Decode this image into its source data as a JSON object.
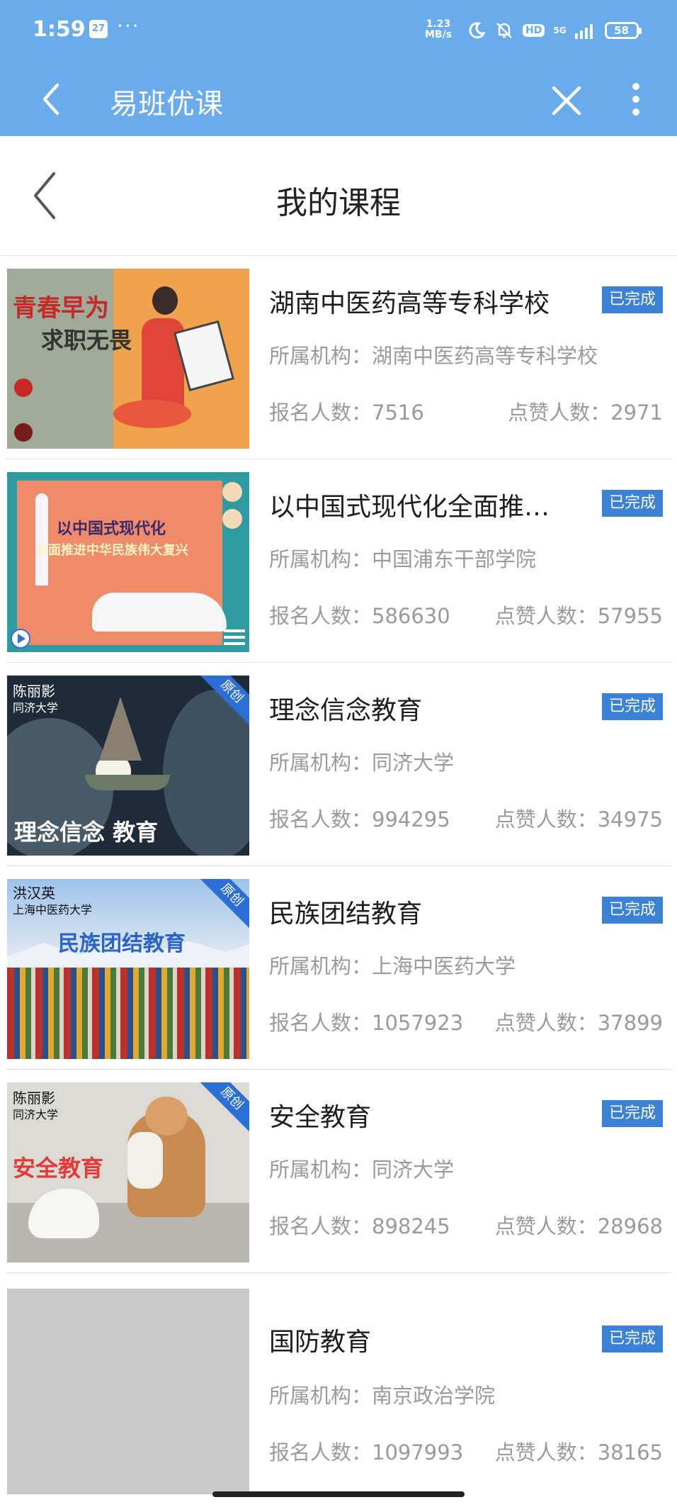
{
  "status_bar": {
    "time": "1:59",
    "date_badge": "27",
    "dots": "···",
    "net_speed_value": "1.23",
    "net_speed_unit": "MB/s",
    "hd": "HD",
    "signal": "5G",
    "battery": "58"
  },
  "app_bar": {
    "title": "易班优课"
  },
  "page": {
    "title": "我的课程"
  },
  "courses": [
    {
      "title": "湖南中医药高等专科学校",
      "status": "已完成",
      "org": "所属机构：湖南中医药高等专科学校",
      "enroll": "报名人数：7516",
      "likes": "点赞人数：2971",
      "thumb_text": [
        "青春早为",
        "求职无畏"
      ]
    },
    {
      "title": "以中国式现代化全面推进中华民族伟大复兴",
      "status": "已完成",
      "org": "所属机构：中国浦东干部学院",
      "enroll": "报名人数：586630",
      "likes": "点赞人数：57955",
      "thumb_text": [
        "以中国式现代化",
        "全面推进中华民族伟大复兴"
      ]
    },
    {
      "title": "理念信念教育",
      "status": "已完成",
      "org": "所属机构：同济大学",
      "enroll": "报名人数：994295",
      "likes": "点赞人数：34975",
      "thumb_text": [
        "陈丽影",
        "同济大学",
        "理念信念 教育",
        "原创"
      ]
    },
    {
      "title": "民族团结教育",
      "status": "已完成",
      "org": "所属机构：上海中医药大学",
      "enroll": "报名人数：1057923",
      "likes": "点赞人数：37899",
      "thumb_text": [
        "洪汉英",
        "上海中医药大学",
        "民族团结教育",
        "原创"
      ]
    },
    {
      "title": "安全教育",
      "status": "已完成",
      "org": "所属机构：同济大学",
      "enroll": "报名人数：898245",
      "likes": "点赞人数：28968",
      "thumb_text": [
        "陈丽影",
        "同济大学",
        "安全教育",
        "原创"
      ]
    },
    {
      "title": "国防教育",
      "status": "已完成",
      "org": "所属机构：南京政治学院",
      "enroll": "报名人数：1097993",
      "likes": "点赞人数：38165",
      "thumb_text": []
    }
  ]
}
